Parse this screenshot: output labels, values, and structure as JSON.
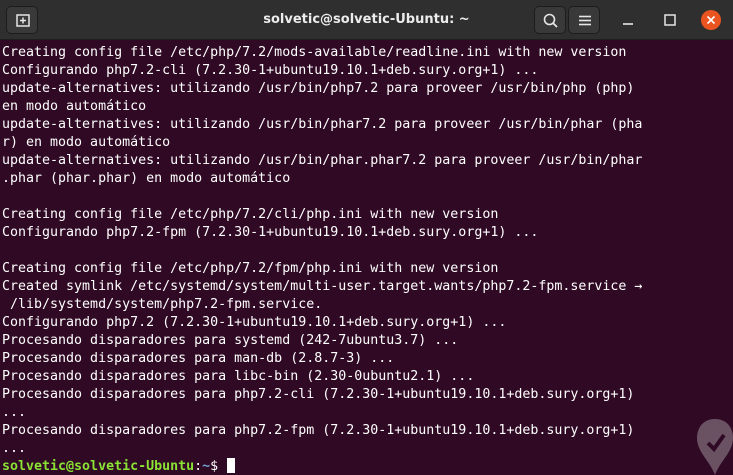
{
  "window": {
    "title": "solvetic@solvetic-Ubuntu: ~"
  },
  "toolbar": {
    "new_tab_icon": "new-tab-icon",
    "search_icon": "search-icon",
    "menu_icon": "hamburger-menu-icon",
    "minimize_icon": "minimize-icon",
    "maximize_icon": "maximize-icon",
    "close_icon": "close-icon"
  },
  "colors": {
    "terminal_bg": "#300a24",
    "titlebar_bg": "#2f2f2f",
    "text": "#ffffff",
    "prompt_user": "#8ae234",
    "prompt_path": "#729fcf",
    "close_button": "#e95420"
  },
  "terminal": {
    "lines": [
      "Creating config file /etc/php/7.2/mods-available/readline.ini with new version",
      "Configurando php7.2-cli (7.2.30-1+ubuntu19.10.1+deb.sury.org+1) ...",
      "update-alternatives: utilizando /usr/bin/php7.2 para proveer /usr/bin/php (php)",
      "en modo automático",
      "update-alternatives: utilizando /usr/bin/phar7.2 para proveer /usr/bin/phar (pha",
      "r) en modo automático",
      "update-alternatives: utilizando /usr/bin/phar.phar7.2 para proveer /usr/bin/phar",
      ".phar (phar.phar) en modo automático",
      "",
      "Creating config file /etc/php/7.2/cli/php.ini with new version",
      "Configurando php7.2-fpm (7.2.30-1+ubuntu19.10.1+deb.sury.org+1) ...",
      "",
      "Creating config file /etc/php/7.2/fpm/php.ini with new version",
      "Created symlink /etc/systemd/system/multi-user.target.wants/php7.2-fpm.service →",
      " /lib/systemd/system/php7.2-fpm.service.",
      "Configurando php7.2 (7.2.30-1+ubuntu19.10.1+deb.sury.org+1) ...",
      "Procesando disparadores para systemd (242-7ubuntu3.7) ...",
      "Procesando disparadores para man-db (2.8.7-3) ...",
      "Procesando disparadores para libc-bin (2.30-0ubuntu2.1) ...",
      "Procesando disparadores para php7.2-cli (7.2.30-1+ubuntu19.10.1+deb.sury.org+1)",
      "...",
      "Procesando disparadores para php7.2-fpm (7.2.30-1+ubuntu19.10.1+deb.sury.org+1)",
      "..."
    ],
    "prompt": {
      "user_host": "solvetic@solvetic-Ubuntu",
      "separator": ":",
      "path": "~",
      "symbol": "$ "
    }
  }
}
